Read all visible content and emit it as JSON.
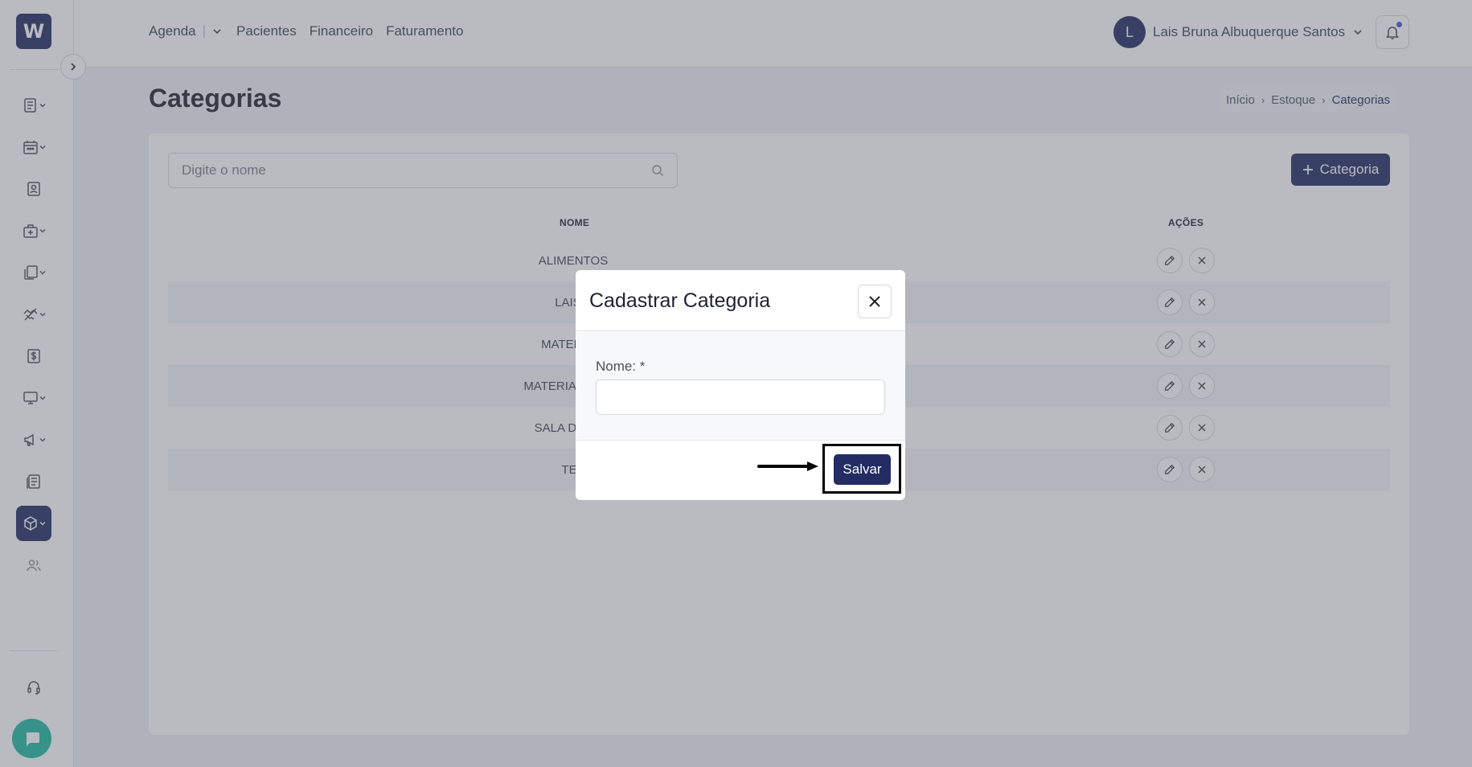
{
  "sidebar": {
    "logo_letter": "W",
    "icons": [
      "clipboard-list-icon",
      "calendar-icon",
      "patient-badge-icon",
      "medical-kit-icon",
      "documents-icon",
      "handshake-icon",
      "dollar-icon",
      "monitor-icon",
      "megaphone-icon",
      "report-icon",
      "package-icon",
      "users-icon",
      "headset-icon"
    ],
    "active": "package-icon"
  },
  "topnav": {
    "items": [
      "Agenda",
      "Pacientes",
      "Financeiro",
      "Faturamento"
    ],
    "divider": "|"
  },
  "user": {
    "initial": "L",
    "name": "Lais Bruna Albuquerque Santos"
  },
  "page": {
    "title": "Categorias"
  },
  "breadcrumb": {
    "items": [
      "Início",
      "Estoque",
      "Categorias"
    ]
  },
  "search": {
    "placeholder": "Digite o nome"
  },
  "add_button": {
    "label": "Categoria"
  },
  "table": {
    "columns": [
      "NOME",
      "AÇÕES"
    ],
    "rows": [
      "ALIMENTOS",
      "LAIS T",
      "MATERIAIS",
      "MATERIAL DE RE",
      "SALA DE EXA",
      "TES"
    ]
  },
  "modal": {
    "title": "Cadastrar Categoria",
    "field_label": "Nome: *",
    "field_value": "",
    "save_label": "Salvar"
  },
  "colors": {
    "primary": "#232c63",
    "chat": "#1fb8a0",
    "notification_dot": "#3f5bd9"
  }
}
